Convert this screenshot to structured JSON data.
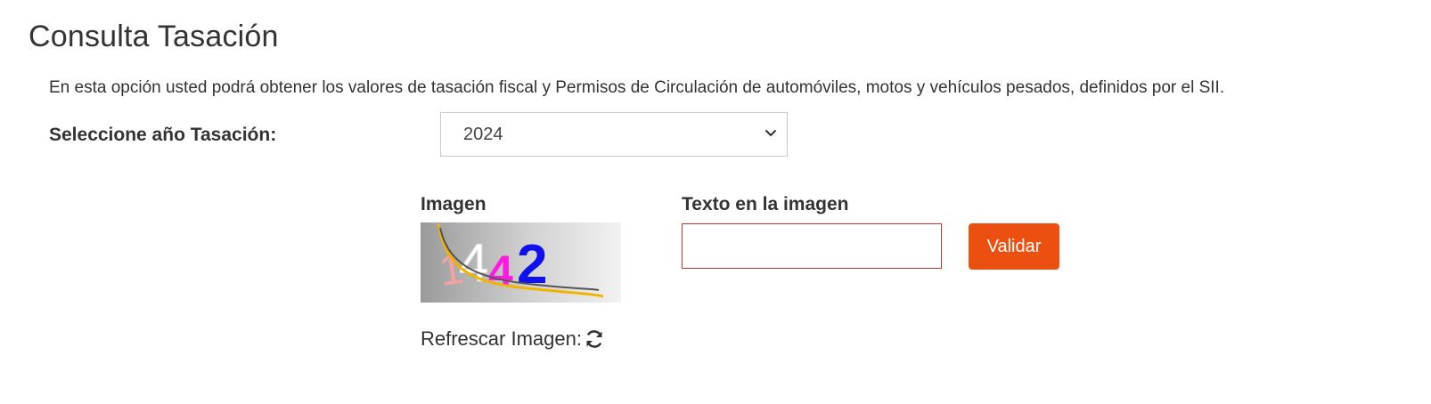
{
  "page": {
    "title": "Consulta Tasación",
    "intro": "En esta opción usted podrá obtener los valores de tasación fiscal y Permisos de Circulación de automóviles, motos y vehículos pesados, definidos por el SII."
  },
  "year_selector": {
    "label": "Seleccione año Tasación:",
    "selected": "2024",
    "icon": "chevron-down-icon"
  },
  "captcha": {
    "image_heading": "Imagen",
    "image_text": "1442",
    "text_heading": "Texto en la imagen",
    "input_value": "",
    "validate_label": "Validar",
    "refresh_label": "Refrescar Imagen:",
    "refresh_icon": "refresh-icon"
  },
  "colors": {
    "accent": "#eb5010",
    "input_border": "#c0392b",
    "text": "#333333"
  }
}
